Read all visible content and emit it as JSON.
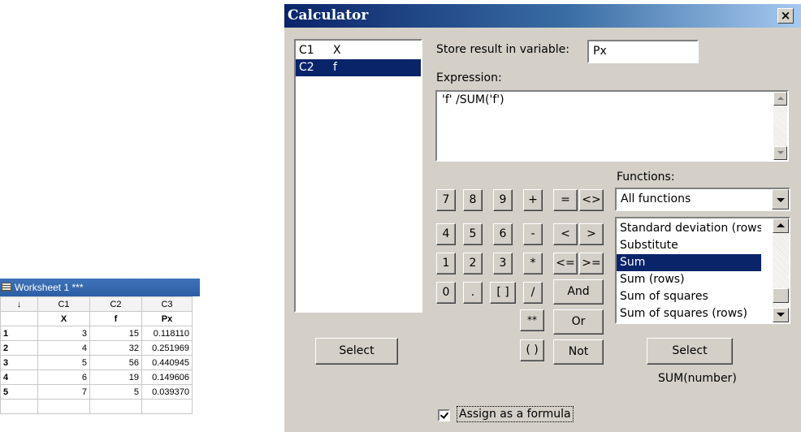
{
  "worksheet": {
    "title": "Worksheet 1 ***",
    "header": [
      "↓",
      "C1",
      "C2",
      "C3"
    ],
    "names": [
      "X",
      "f",
      "Px"
    ],
    "rows": [
      {
        "n": "1",
        "c1": "3",
        "c2": "15",
        "c3": "0.118110"
      },
      {
        "n": "2",
        "c1": "4",
        "c2": "32",
        "c3": "0.251969"
      },
      {
        "n": "3",
        "c1": "5",
        "c2": "56",
        "c3": "0.440945"
      },
      {
        "n": "4",
        "c1": "6",
        "c2": "19",
        "c3": "0.149606"
      },
      {
        "n": "5",
        "c1": "7",
        "c2": "5",
        "c3": "0.039370"
      }
    ]
  },
  "dialog": {
    "title": "Calculator",
    "close_label": "×",
    "variables": [
      {
        "col": "C1",
        "name": "X",
        "selected": false
      },
      {
        "col": "C2",
        "name": "f",
        "selected": true
      }
    ],
    "store_label": "Store result in variable:",
    "store_value": "Px",
    "expression_label": "Expression:",
    "expression": "'f' /SUM('f')",
    "keypad": {
      "digits": [
        "7",
        "8",
        "9",
        "4",
        "5",
        "6",
        "1",
        "2",
        "3",
        "0",
        ".",
        "[ ]"
      ],
      "ops": [
        "+",
        "-",
        "*",
        "/",
        "**",
        "( )"
      ],
      "compare": [
        "=",
        "<>",
        "<",
        ">",
        "<=",
        ">="
      ],
      "logic": [
        "And",
        "Or",
        "Not"
      ]
    },
    "functions_label": "Functions:",
    "functions_category": "All functions",
    "functions": [
      {
        "label": "Standard deviation (rows)",
        "selected": false
      },
      {
        "label": "Substitute",
        "selected": false
      },
      {
        "label": "Sum",
        "selected": true
      },
      {
        "label": "Sum (rows)",
        "selected": false
      },
      {
        "label": "Sum of squares",
        "selected": false
      },
      {
        "label": "Sum of squares (rows)",
        "selected": false
      }
    ],
    "select_left_label": "Select",
    "select_right_label": "Select",
    "function_signature": "SUM(number)",
    "assign_label": "Assign as a formula",
    "assign_checked": true
  }
}
